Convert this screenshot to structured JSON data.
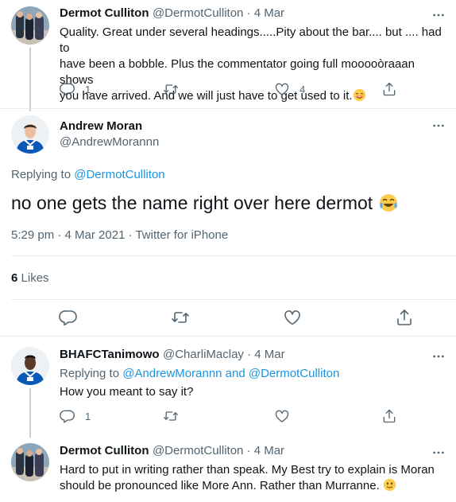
{
  "tweet1": {
    "name": "Dermot Culliton",
    "handle_time": "@DermotCulliton · 4 Mar",
    "line1": "Quality. Great under several headings.....Pity about the bar.... but .... had to",
    "line2": "have been a bobble. Plus the commentator going full mooooòraaan shows",
    "line3": "you have arrived. And we will just have to get used to it.",
    "reply_count": "1",
    "like_count": "4"
  },
  "main": {
    "name": "Andrew Moran",
    "handle": "@AndrewMorannn",
    "replying_prefix": "Replying to ",
    "replying_to": "@DermotCulliton",
    "text": "no one gets the name right over here dermot",
    "meta": "5:29 pm · 4 Mar 2021 · Twitter for iPhone",
    "likes_count": "6",
    "likes_label": "Likes"
  },
  "tweet3": {
    "name": "BHAFCTanimowo",
    "handle_time": "@CharliMaclay · 4 Mar",
    "replying_prefix": "Replying to ",
    "replying_to": "@AndrewMorannn and @DermotCulliton",
    "text": "How you meant to say it?",
    "reply_count": "1"
  },
  "tweet4": {
    "name": "Dermot Culliton",
    "handle_time": "@DermotCulliton · 4 Mar",
    "line1": "Hard to put in writing rather than speak. My Best try to explain is Moran",
    "line2": "should be pronounced like More Ann. Rather than Murranne."
  },
  "colors": {
    "link": "#1b95e0",
    "muted": "#536471",
    "divider": "#e6ecf0"
  }
}
